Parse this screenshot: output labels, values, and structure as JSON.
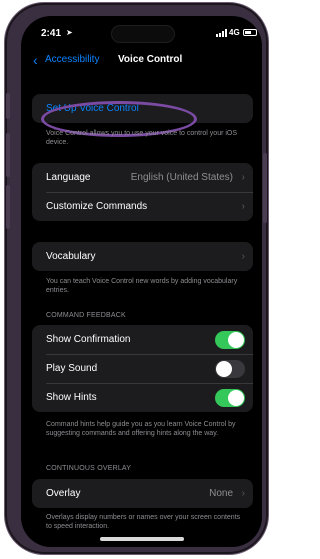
{
  "status_bar": {
    "time": "2:41",
    "carrier": "4G"
  },
  "nav": {
    "back_label": "Accessibility",
    "title": "Voice Control"
  },
  "setup": {
    "label": "Set Up Voice Control",
    "footnote": "Voice Control allows you to use your voice to control your iOS device."
  },
  "language_group": {
    "language_label": "Language",
    "language_value": "English (United States)",
    "customize_label": "Customize Commands"
  },
  "vocabulary": {
    "label": "Vocabulary",
    "footnote": "You can teach Voice Control new words by adding vocabulary entries."
  },
  "command_feedback": {
    "header": "COMMAND FEEDBACK",
    "items": [
      {
        "label": "Show Confirmation",
        "on": true
      },
      {
        "label": "Play Sound",
        "on": false
      },
      {
        "label": "Show Hints",
        "on": true
      }
    ],
    "footnote": "Command hints help guide you as you learn Voice Control by suggesting commands and offering hints along the way."
  },
  "continuous_overlay": {
    "header": "CONTINUOUS OVERLAY",
    "overlay_label": "Overlay",
    "overlay_value": "None",
    "footnote": "Overlays display numbers or names over your screen contents to speed interaction."
  },
  "colors": {
    "accent": "#0a84ff",
    "toggle_on": "#34c759",
    "highlight": "#7b4aa3",
    "background": "#000000",
    "cell": "#1c1c1e"
  },
  "icons": [
    "location-arrow-icon",
    "cellular-signal-icon",
    "battery-icon",
    "back-chevron-icon",
    "chevron-right-icon"
  ]
}
